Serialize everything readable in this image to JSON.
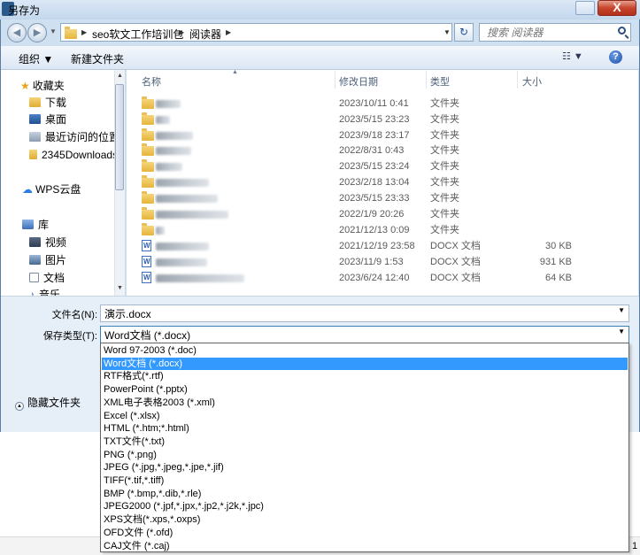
{
  "window": {
    "title": "另存为",
    "close_label": "X"
  },
  "address": {
    "crumbs": [
      "seo软文工作培训包",
      "阅读器"
    ]
  },
  "search": {
    "placeholder": "搜索 阅读器"
  },
  "toolbar": {
    "organize_label": "组织 ▼",
    "new_folder_label": "新建文件夹",
    "view_label": "☷ ▼",
    "help_label": "?"
  },
  "nav": {
    "groups": [
      {
        "label": "收藏夹",
        "icon": "star-icon"
      },
      {
        "label": "下载",
        "icon": "download-folder-icon"
      },
      {
        "label": "桌面",
        "icon": "desktop-icon"
      },
      {
        "label": "最近访问的位置",
        "icon": "recent-places-icon"
      },
      {
        "label": "2345Downloads",
        "icon": "folder-icon"
      },
      {
        "label": "WPS云盘",
        "icon": "cloud-icon"
      },
      {
        "label": "库",
        "icon": "library-icon"
      },
      {
        "label": "视频",
        "icon": "video-library-icon"
      },
      {
        "label": "图片",
        "icon": "picture-library-icon"
      },
      {
        "label": "文档",
        "icon": "document-library-icon"
      },
      {
        "label": "音乐",
        "icon": "music-library-icon"
      }
    ]
  },
  "columns": {
    "name": "名称",
    "modified": "修改日期",
    "type": "类型",
    "size": "大小"
  },
  "files": [
    {
      "date": "2023/10/11 0:41",
      "type": "文件夹",
      "size": "",
      "kind": "folder"
    },
    {
      "date": "2023/5/15 23:23",
      "type": "文件夹",
      "size": "",
      "kind": "folder"
    },
    {
      "date": "2023/9/18 23:17",
      "type": "文件夹",
      "size": "",
      "kind": "folder"
    },
    {
      "date": "2022/8/31 0:43",
      "type": "文件夹",
      "size": "",
      "kind": "folder"
    },
    {
      "date": "2023/5/15 23:24",
      "type": "文件夹",
      "size": "",
      "kind": "folder"
    },
    {
      "date": "2023/2/18 13:04",
      "type": "文件夹",
      "size": "",
      "kind": "folder"
    },
    {
      "date": "2023/5/15 23:33",
      "type": "文件夹",
      "size": "",
      "kind": "folder"
    },
    {
      "date": "2022/1/9 20:26",
      "type": "文件夹",
      "size": "",
      "kind": "folder"
    },
    {
      "date": "2021/12/13 0:09",
      "type": "文件夹",
      "size": "",
      "kind": "folder"
    },
    {
      "date": "2021/12/19 23:58",
      "type": "DOCX 文档",
      "size": "30 KB",
      "kind": "docx"
    },
    {
      "date": "2023/11/9 1:53",
      "type": "DOCX 文档",
      "size": "931 KB",
      "kind": "docx"
    },
    {
      "date": "2023/6/24 12:40",
      "type": "DOCX 文档",
      "size": "64 KB",
      "kind": "docx"
    }
  ],
  "form": {
    "filename_label": "文件名(N):",
    "filename_value": "演示.docx",
    "filetype_label": "保存类型(T):",
    "filetype_value": "Word文档 (*.docx)",
    "hide_folders_label": "隐藏文件夹"
  },
  "filetype_options": [
    "Word 97-2003 (*.doc)",
    "Word文档 (*.docx)",
    "RTF格式(*.rtf)",
    "PowerPoint (*.pptx)",
    "XML电子表格2003 (*.xml)",
    "Excel (*.xlsx)",
    "HTML (*.htm;*.html)",
    "TXT文件(*.txt)",
    "PNG (*.png)",
    "JPEG (*.jpg,*.jpeg,*.jpe,*.jif)",
    "TIFF(*.tif,*.tiff)",
    "BMP (*.bmp,*.dib,*.rle)",
    "JPEG2000 (*.jpf,*.jpx,*.jp2,*.j2k,*.jpc)",
    "XPS文档(*.xps,*.oxps)",
    "OFD文件 (*.ofd)",
    "CAJ文件 (*.caj)"
  ],
  "selected_option_index": 1,
  "background": {
    "right_fragment": "1"
  }
}
